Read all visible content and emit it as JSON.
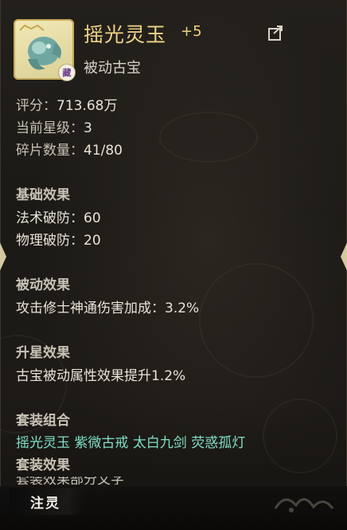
{
  "item": {
    "name": "摇光灵玉",
    "level": "+5",
    "type": "被动古宝",
    "badge_char": "藏"
  },
  "stats": {
    "score_label": "评分：",
    "score_value": "713.68万",
    "star_label": "当前星级：",
    "star_value": "3",
    "shard_label": "碎片数量：",
    "shard_value": "41/80"
  },
  "sections": {
    "base_title": "基础效果",
    "base_lines": [
      {
        "label": "法术破防：",
        "value": "60"
      },
      {
        "label": "物理破防：",
        "value": "20"
      }
    ],
    "passive_title": "被动效果",
    "passive_text": "攻击修士神通伤害加成：3.2%",
    "upgrade_title": "升星效果",
    "upgrade_text": "古宝被动属性效果提升1.2%",
    "set_title": "套装组合",
    "set_items": [
      "摇光灵玉",
      "紫微古戒",
      "太白九剑",
      "荧惑孤灯"
    ],
    "set_effect_title": "套装效果",
    "set_effect_partial": "套装效果部分文字"
  },
  "buttons": {
    "inject": "注灵"
  },
  "icons": {
    "share": "share-icon",
    "item": "jade-pendant-icon",
    "nav_left": "left-arrow-icon",
    "nav_right": "right-arrow-icon"
  },
  "colors": {
    "gold": "#f0d487",
    "set_green": "#7fe0c6",
    "text": "#e9e4d8"
  }
}
